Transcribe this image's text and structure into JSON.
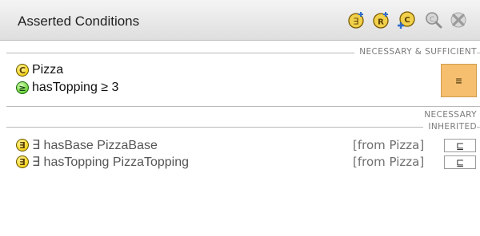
{
  "panel": {
    "title": "Asserted Conditions",
    "toolbar": [
      {
        "icon": "add-restriction-icon",
        "color": "#e8c23a"
      },
      {
        "icon": "add-named-class-icon",
        "color": "#e8c23a"
      },
      {
        "icon": "add-anonymous-class-icon",
        "color": "#d59c2a"
      },
      {
        "icon": "search-icon",
        "color": "#9a9a9a"
      },
      {
        "icon": "delete-icon",
        "color": "#9a9a9a"
      }
    ]
  },
  "sections": {
    "necessary_sufficient": {
      "label": "NECESSARY & SUFFICIENT",
      "conditions": [
        {
          "badge": "C",
          "text": "Pizza"
        },
        {
          "badge": "≥",
          "text": "hasTopping ≥ 3"
        }
      ],
      "operator": "≡"
    },
    "necessary": {
      "label": "NECESSARY"
    },
    "inherited": {
      "label": "INHERITED",
      "conditions": [
        {
          "badge": "∃",
          "text": "∃ hasBase PizzaBase",
          "source": "[from Pizza]",
          "operator": "⊑"
        },
        {
          "badge": "∃",
          "text": "∃ hasTopping PizzaTopping",
          "source": "[from Pizza]",
          "operator": "⊑"
        }
      ]
    }
  }
}
